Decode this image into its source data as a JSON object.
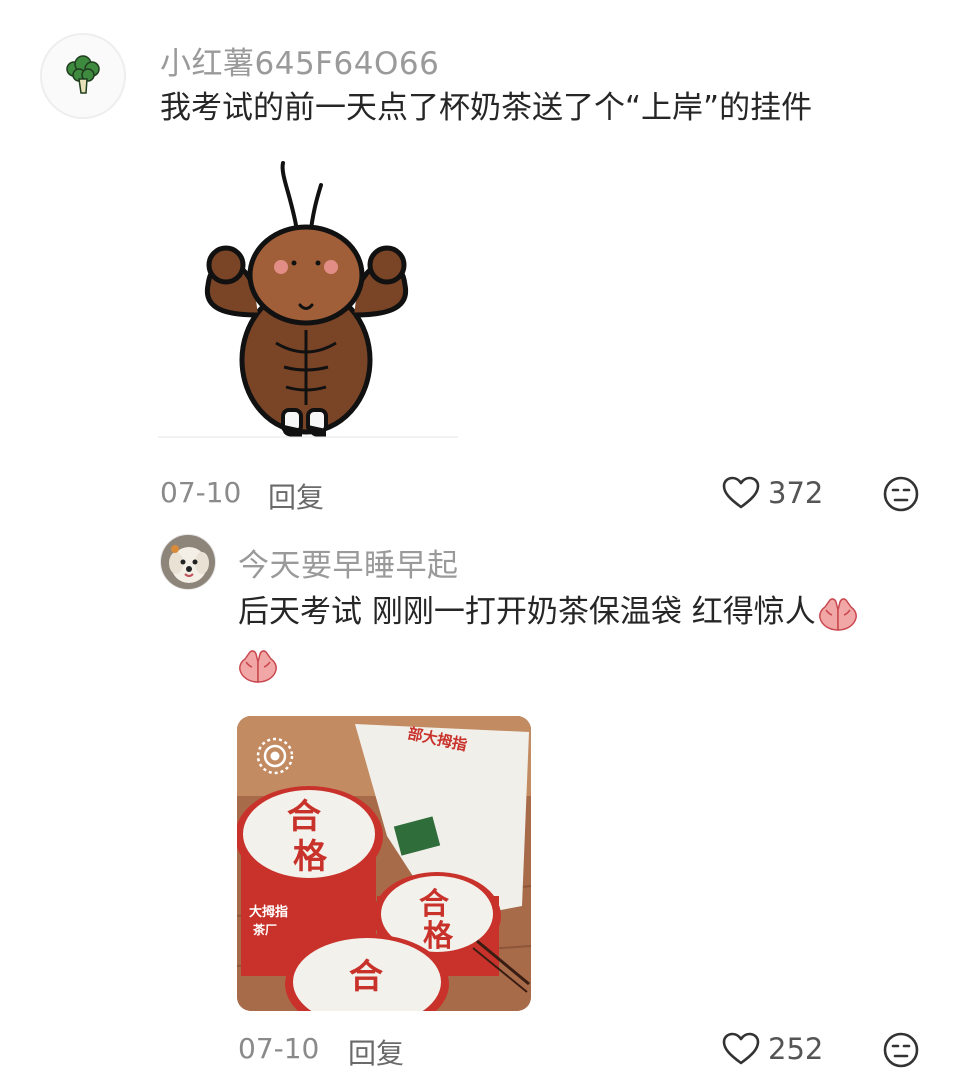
{
  "comment1": {
    "username": "小红薯645F64O66",
    "text": "我考试的前一天点了杯奶茶送了个“上岸”的挂件",
    "date": "07-10",
    "reply_label": "回复",
    "likes": "372"
  },
  "comment2": {
    "username": "今天要早睡早起",
    "text_line1": "后天考试 刚刚一打开奶茶保温袋 红得惊人",
    "date": "07-10",
    "reply_label": "回复",
    "likes": "252",
    "photo": {
      "bag_text": "部大拇指",
      "cup_chars": [
        "合",
        "格"
      ],
      "sleeve_text_1": "大拇指",
      "sleeve_text_2": "茶厂"
    }
  },
  "colors": {
    "username": "#9a9a9a",
    "text": "#262626",
    "accent_red": "#c8322b"
  },
  "icons": [
    "broccoli-avatar-icon",
    "muscle-bug-sticker",
    "heart-icon",
    "meh-face-icon",
    "pray-hands-emoji",
    "live-photo-icon"
  ]
}
